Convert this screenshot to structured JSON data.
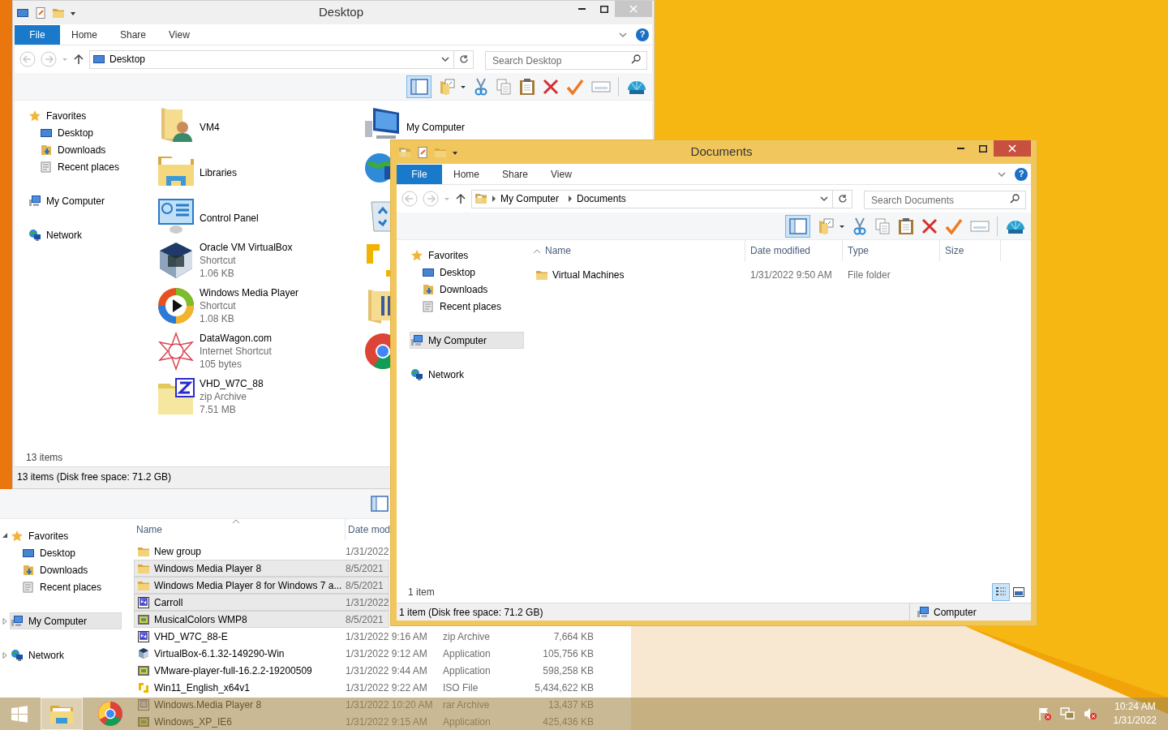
{
  "background_window": {
    "preview_pane": {
      "selected": false
    },
    "nav": [
      {
        "label": "Favorites",
        "kind": "star",
        "selected": false,
        "expanded": true,
        "children": [
          {
            "label": "Desktop",
            "kind": "desktop",
            "selected": false
          },
          {
            "label": "Downloads",
            "kind": "downloads",
            "selected": false
          },
          {
            "label": "Recent places",
            "kind": "recent",
            "selected": false
          }
        ]
      },
      {
        "label": "My Computer",
        "kind": "computer",
        "selected": true,
        "expanded": false
      },
      {
        "label": "Network",
        "kind": "network",
        "selected": false,
        "expanded": false
      }
    ],
    "columns": [
      "Name",
      "Date mod"
    ],
    "rows": [
      {
        "kind": "folder",
        "name": "New group",
        "date": "1/31/2022",
        "selected": false
      },
      {
        "kind": "folder",
        "name": "Windows Media Player 8",
        "date": "8/5/2021",
        "selected": true
      },
      {
        "kind": "folder",
        "name": "Windows Media Player 8 for Windows 7 a...",
        "date": "8/5/2021",
        "selected": true
      },
      {
        "kind": "zip_doc",
        "name": "Carroll",
        "date": "1/31/2022",
        "selected": true
      },
      {
        "kind": "app",
        "name": "MusicalColors WMP8",
        "date": "8/5/2021",
        "selected": true
      },
      {
        "kind": "zip_doc",
        "name": "VHD_W7C_88-E",
        "date": "1/31/2022 9:16 AM",
        "type": "zip Archive",
        "size": "7,664 KB",
        "selected": false
      },
      {
        "kind": "cube",
        "name": "VirtualBox-6.1.32-149290-Win",
        "date": "1/31/2022 9:12 AM",
        "type": "Application",
        "size": "105,756 KB",
        "selected": false
      },
      {
        "kind": "app",
        "name": "VMware-player-full-16.2.2-19200509",
        "date": "1/31/2022 9:44 AM",
        "type": "Application",
        "size": "598,258 KB",
        "selected": false
      },
      {
        "kind": "arrows_small",
        "name": "Win11_English_x64v1",
        "date": "1/31/2022 9:22 AM",
        "type": "ISO File",
        "size": "5,434,622 KB",
        "selected": false
      },
      {
        "kind": "rar",
        "name": "Windows.Media Player 8",
        "date": "1/31/2022 10:20 AM",
        "type": "rar Archive",
        "size": "13,437 KB",
        "selected": false
      },
      {
        "kind": "app",
        "name": "Windows_XP_IE6",
        "date": "1/31/2022 9:15 AM",
        "type": "Application",
        "size": "425,436 KB",
        "selected": false
      }
    ]
  },
  "desktop_window": {
    "title": "Desktop",
    "active": false,
    "ribbon_tabs": [
      {
        "label": "File",
        "kind": "file"
      },
      {
        "label": "Home",
        "kind": "tab"
      },
      {
        "label": "Share",
        "kind": "tab"
      },
      {
        "label": "View",
        "kind": "tab"
      }
    ],
    "help": "?",
    "address": {
      "kind": "desktop",
      "path": [
        "Desktop"
      ]
    },
    "search": {
      "placeholder": "Search Desktop"
    },
    "preview_pane": {
      "selected": true
    },
    "nav": [
      {
        "label": "Favorites",
        "kind": "star",
        "selected": false,
        "children": [
          {
            "label": "Desktop",
            "kind": "desktop",
            "selected": false
          },
          {
            "label": "Downloads",
            "kind": "downloads",
            "selected": false
          },
          {
            "label": "Recent places",
            "kind": "recent",
            "selected": false
          }
        ]
      },
      {
        "label": "My Computer",
        "kind": "computer",
        "selected": false
      },
      {
        "label": "Network",
        "kind": "network",
        "selected": false
      }
    ],
    "items": [
      {
        "kind": "folder_user",
        "name": "VM4"
      },
      {
        "kind": "libraries",
        "name": "Libraries"
      },
      {
        "kind": "control_panel",
        "name": "Control Panel"
      },
      {
        "kind": "cube",
        "name": "Oracle VM VirtualBox",
        "details": [
          "Shortcut",
          "1.06 KB"
        ]
      },
      {
        "kind": "media_player",
        "name": "Windows Media Player",
        "details": [
          "Shortcut",
          "1.08 KB"
        ]
      },
      {
        "kind": "star_pattern",
        "name": "DataWagon.com",
        "details": [
          "Internet Shortcut",
          "105 bytes"
        ]
      },
      {
        "kind": "zip",
        "name": "VHD_W7C_88",
        "details": [
          "zip Archive",
          "7.51 MB"
        ]
      },
      {
        "kind": "computer_large",
        "name": "My Computer"
      },
      {
        "kind": "globe_computer"
      },
      {
        "kind": "recycle_bin"
      },
      {
        "kind": "arrows"
      },
      {
        "kind": "folder_large"
      },
      {
        "kind": "round_logo"
      }
    ],
    "item_count": "13 items",
    "status": "13 items (Disk free space: 71.2 GB)"
  },
  "documents_window": {
    "title": "Documents",
    "active": true,
    "ribbon_tabs": [
      {
        "label": "File",
        "kind": "file"
      },
      {
        "label": "Home",
        "kind": "tab"
      },
      {
        "label": "Share",
        "kind": "tab"
      },
      {
        "label": "View",
        "kind": "tab"
      }
    ],
    "help": "?",
    "address": {
      "kind": "folder_doc",
      "path": [
        "My Computer",
        "Documents"
      ]
    },
    "search": {
      "placeholder": "Search Documents"
    },
    "preview_pane": {
      "selected": true
    },
    "nav": [
      {
        "label": "Favorites",
        "kind": "star",
        "selected": false,
        "children": [
          {
            "label": "Desktop",
            "kind": "desktop",
            "selected": false
          },
          {
            "label": "Downloads",
            "kind": "downloads",
            "selected": false
          },
          {
            "label": "Recent places",
            "kind": "recent",
            "selected": false
          }
        ]
      },
      {
        "label": "My Computer",
        "kind": "computer",
        "selected": true
      },
      {
        "label": "Network",
        "kind": "network",
        "selected": false
      }
    ],
    "columns": [
      "Name",
      "Date modified",
      "Type",
      "Size"
    ],
    "rows": [
      {
        "kind": "folder",
        "name": "Virtual Machines",
        "date": "1/31/2022 9:50 AM",
        "type": "File folder",
        "selected": false
      }
    ],
    "item_count": "1 item",
    "view_buttons": [
      {
        "kind": "details",
        "selected": true
      },
      {
        "kind": "large_icons",
        "selected": false
      }
    ],
    "status": "1 item (Disk free space: 71.2 GB)",
    "status_location": "Computer"
  },
  "taskbar": {
    "buttons": [
      {
        "kind": "start",
        "selected": false
      },
      {
        "kind": "explorer",
        "selected": true
      },
      {
        "kind": "browser",
        "selected": false
      }
    ],
    "time": "10:24 AM",
    "date": "1/31/2022"
  }
}
